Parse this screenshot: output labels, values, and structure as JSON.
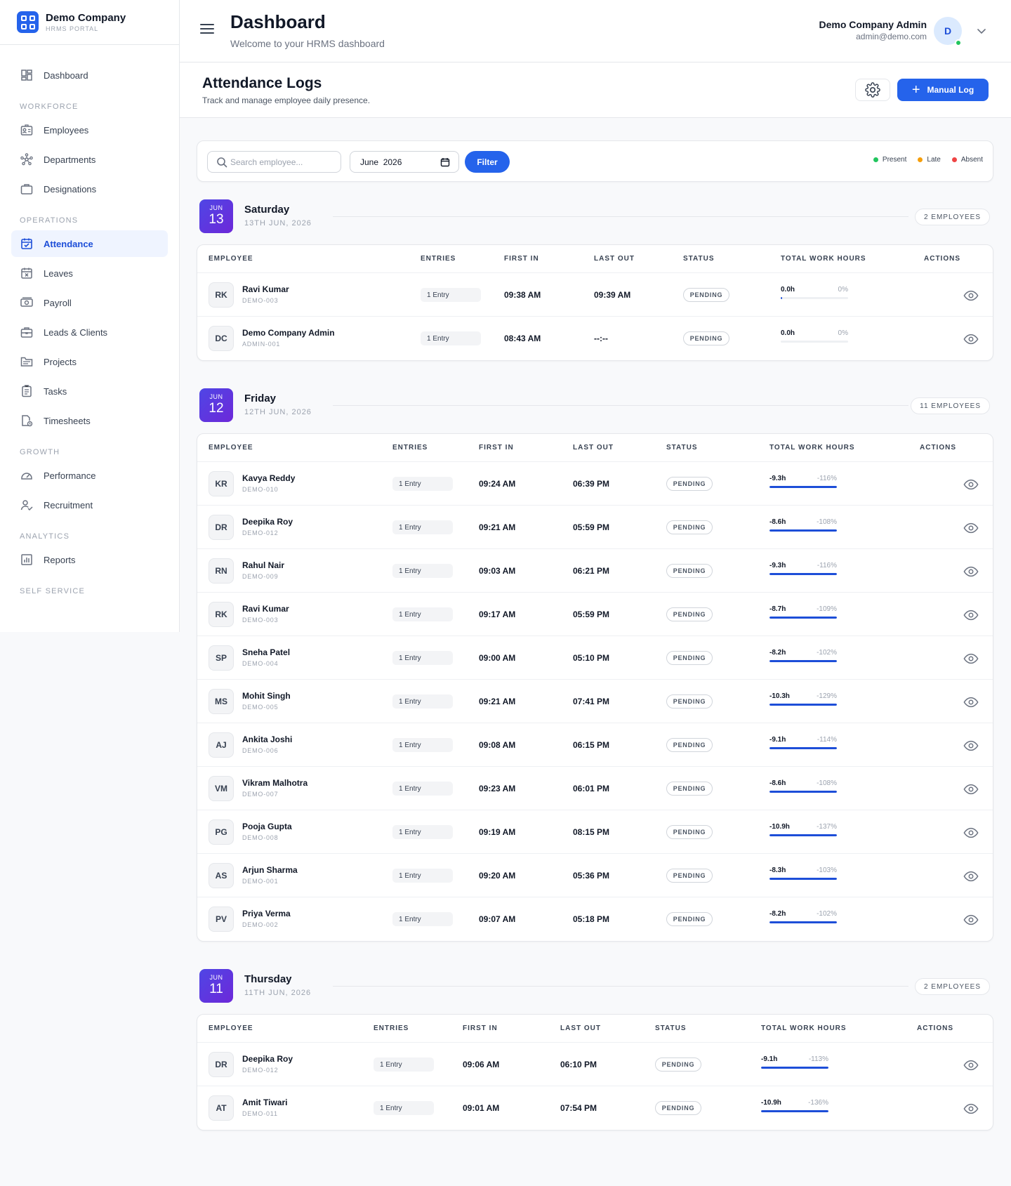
{
  "brand": {
    "name": "Demo Company",
    "sub": "HRMS PORTAL"
  },
  "sidebar": {
    "items": [
      {
        "section": "",
        "label": "Dashboard",
        "icon": "dashboard-icon",
        "active": false
      },
      {
        "section": "WORKFORCE",
        "label": "Employees",
        "icon": "id-card-icon",
        "active": false
      },
      {
        "section": "",
        "label": "Departments",
        "icon": "network-icon",
        "active": false
      },
      {
        "section": "",
        "label": "Designations",
        "icon": "briefcase-icon",
        "active": false
      },
      {
        "section": "OPERATIONS",
        "label": "Attendance",
        "icon": "calendar-check-icon",
        "active": true
      },
      {
        "section": "",
        "label": "Leaves",
        "icon": "calendar-x-icon",
        "active": false
      },
      {
        "section": "",
        "label": "Payroll",
        "icon": "money-icon",
        "active": false
      },
      {
        "section": "",
        "label": "Leads & Clients",
        "icon": "case-icon",
        "active": false
      },
      {
        "section": "",
        "label": "Projects",
        "icon": "folder-icon",
        "active": false
      },
      {
        "section": "",
        "label": "Tasks",
        "icon": "clipboard-icon",
        "active": false
      },
      {
        "section": "",
        "label": "Timesheets",
        "icon": "clock-file-icon",
        "active": false
      },
      {
        "section": "GROWTH",
        "label": "Performance",
        "icon": "gauge-icon",
        "active": false
      },
      {
        "section": "",
        "label": "Recruitment",
        "icon": "user-check-icon",
        "active": false
      },
      {
        "section": "ANALYTICS",
        "label": "Reports",
        "icon": "bar-chart-icon",
        "active": false
      }
    ],
    "trailing_section": "SELF SERVICE"
  },
  "header": {
    "title": "Dashboard",
    "subtitle": "Welcome to your HRMS dashboard",
    "user_name": "Demo Company Admin",
    "user_email": "admin@demo.com",
    "avatar_initial": "D"
  },
  "subheader": {
    "title": "Attendance Logs",
    "subtitle": "Track and manage employee daily presence.",
    "manual_log_label": "Manual Log"
  },
  "filters": {
    "search_placeholder": "Search employee...",
    "month_value": "June  2026",
    "filter_label": "Filter",
    "legend": [
      {
        "label": "Present",
        "color": "#22c55e"
      },
      {
        "label": "Late",
        "color": "#f59e0b"
      },
      {
        "label": "Absent",
        "color": "#ef4444"
      }
    ]
  },
  "columns": {
    "employee": "EMPLOYEE",
    "entries": "ENTRIES",
    "first_in": "FIRST IN",
    "last_out": "LAST OUT",
    "status": "STATUS",
    "hours": "TOTAL WORK HOURS",
    "actions": "ACTIONS"
  },
  "days": [
    {
      "month": "JUN",
      "day": "13",
      "weekday": "Saturday",
      "full": "13TH JUN, 2026",
      "count_label": "2 EMPLOYEES",
      "rows": [
        {
          "initials": "RK",
          "name": "Ravi Kumar",
          "id": "DEMO-003",
          "entries": "1 Entry",
          "first_in": "09:38 AM",
          "last_out": "09:39 AM",
          "status": "PENDING",
          "hours": "0.0h",
          "pct": "0%",
          "fill": 0.02
        },
        {
          "initials": "DC",
          "name": "Demo Company Admin",
          "id": "ADMIN-001",
          "entries": "1 Entry",
          "first_in": "08:43 AM",
          "last_out": "--:--",
          "status": "PENDING",
          "hours": "0.0h",
          "pct": "0%",
          "fill": 0
        }
      ]
    },
    {
      "month": "JUN",
      "day": "12",
      "weekday": "Friday",
      "full": "12TH JUN, 2026",
      "count_label": "11 EMPLOYEES",
      "rows": [
        {
          "initials": "KR",
          "name": "Kavya Reddy",
          "id": "DEMO-010",
          "entries": "1 Entry",
          "first_in": "09:24 AM",
          "last_out": "06:39 PM",
          "status": "PENDING",
          "hours": "-9.3h",
          "pct": "-116%",
          "fill": 1
        },
        {
          "initials": "DR",
          "name": "Deepika Roy",
          "id": "DEMO-012",
          "entries": "1 Entry",
          "first_in": "09:21 AM",
          "last_out": "05:59 PM",
          "status": "PENDING",
          "hours": "-8.6h",
          "pct": "-108%",
          "fill": 1
        },
        {
          "initials": "RN",
          "name": "Rahul Nair",
          "id": "DEMO-009",
          "entries": "1 Entry",
          "first_in": "09:03 AM",
          "last_out": "06:21 PM",
          "status": "PENDING",
          "hours": "-9.3h",
          "pct": "-116%",
          "fill": 1
        },
        {
          "initials": "RK",
          "name": "Ravi Kumar",
          "id": "DEMO-003",
          "entries": "1 Entry",
          "first_in": "09:17 AM",
          "last_out": "05:59 PM",
          "status": "PENDING",
          "hours": "-8.7h",
          "pct": "-109%",
          "fill": 1
        },
        {
          "initials": "SP",
          "name": "Sneha Patel",
          "id": "DEMO-004",
          "entries": "1 Entry",
          "first_in": "09:00 AM",
          "last_out": "05:10 PM",
          "status": "PENDING",
          "hours": "-8.2h",
          "pct": "-102%",
          "fill": 1
        },
        {
          "initials": "MS",
          "name": "Mohit Singh",
          "id": "DEMO-005",
          "entries": "1 Entry",
          "first_in": "09:21 AM",
          "last_out": "07:41 PM",
          "status": "PENDING",
          "hours": "-10.3h",
          "pct": "-129%",
          "fill": 1
        },
        {
          "initials": "AJ",
          "name": "Ankita Joshi",
          "id": "DEMO-006",
          "entries": "1 Entry",
          "first_in": "09:08 AM",
          "last_out": "06:15 PM",
          "status": "PENDING",
          "hours": "-9.1h",
          "pct": "-114%",
          "fill": 1
        },
        {
          "initials": "VM",
          "name": "Vikram Malhotra",
          "id": "DEMO-007",
          "entries": "1 Entry",
          "first_in": "09:23 AM",
          "last_out": "06:01 PM",
          "status": "PENDING",
          "hours": "-8.6h",
          "pct": "-108%",
          "fill": 1
        },
        {
          "initials": "PG",
          "name": "Pooja Gupta",
          "id": "DEMO-008",
          "entries": "1 Entry",
          "first_in": "09:19 AM",
          "last_out": "08:15 PM",
          "status": "PENDING",
          "hours": "-10.9h",
          "pct": "-137%",
          "fill": 1
        },
        {
          "initials": "AS",
          "name": "Arjun Sharma",
          "id": "DEMO-001",
          "entries": "1 Entry",
          "first_in": "09:20 AM",
          "last_out": "05:36 PM",
          "status": "PENDING",
          "hours": "-8.3h",
          "pct": "-103%",
          "fill": 1
        },
        {
          "initials": "PV",
          "name": "Priya Verma",
          "id": "DEMO-002",
          "entries": "1 Entry",
          "first_in": "09:07 AM",
          "last_out": "05:18 PM",
          "status": "PENDING",
          "hours": "-8.2h",
          "pct": "-102%",
          "fill": 1
        }
      ]
    },
    {
      "month": "JUN",
      "day": "11",
      "weekday": "Thursday",
      "full": "11TH JUN, 2026",
      "count_label": "2 EMPLOYEES",
      "rows": [
        {
          "initials": "DR",
          "name": "Deepika Roy",
          "id": "DEMO-012",
          "entries": "1 Entry",
          "first_in": "09:06 AM",
          "last_out": "06:10 PM",
          "status": "PENDING",
          "hours": "-9.1h",
          "pct": "-113%",
          "fill": 1
        },
        {
          "initials": "AT",
          "name": "Amit Tiwari",
          "id": "DEMO-011",
          "entries": "1 Entry",
          "first_in": "09:01 AM",
          "last_out": "07:54 PM",
          "status": "PENDING",
          "hours": "-10.9h",
          "pct": "-136%",
          "fill": 1
        }
      ]
    }
  ]
}
